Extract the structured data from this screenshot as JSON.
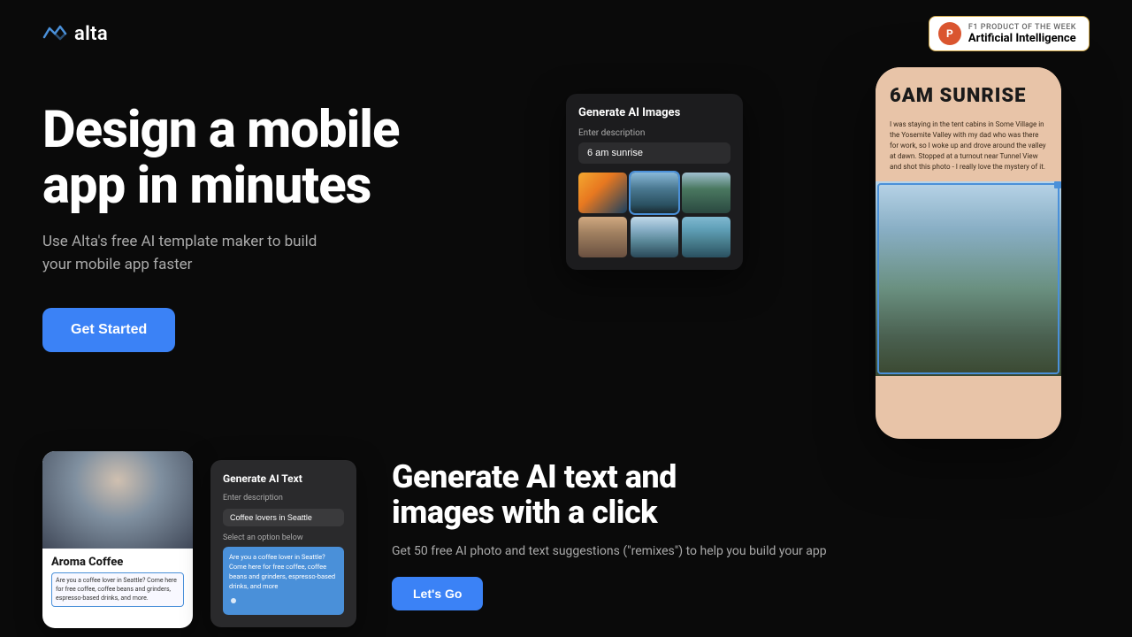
{
  "brand": {
    "logo_text": "alta",
    "logo_icon_label": "alta-logo-icon"
  },
  "product_hunt": {
    "label": "F1 PRODUCT OF THE WEEK",
    "title": "Artificial Intelligence",
    "icon_letter": "P"
  },
  "hero": {
    "headline_line1": "Design a mobile",
    "headline_line2": "app in minutes",
    "subtext": "Use Alta's free AI template maker to build your mobile app faster",
    "cta_button": "Get Started"
  },
  "mobile_app": {
    "title": "6AM SUNRISE",
    "body": "I was staying in the tent cabins in Some Village in the Yosemite Valley with my dad who was there for work, so I woke up and drove around the valley at dawn. Stopped at a turnout near Tunnel View and shot this photo - I really love the mystery of it."
  },
  "ai_images_popup": {
    "title": "Generate AI Images",
    "input_label": "Enter description",
    "input_value": "6 am sunrise",
    "images": [
      {
        "name": "sunrise-thumb",
        "style": "sunrise"
      },
      {
        "name": "mountain-thumb",
        "style": "mountain",
        "selected": true
      },
      {
        "name": "forest-thumb",
        "style": "forest"
      },
      {
        "name": "lake-thumb",
        "style": "lake"
      },
      {
        "name": "valley-thumb",
        "style": "valley"
      },
      {
        "name": "canyon-thumb",
        "style": "canyon"
      }
    ]
  },
  "bottom_section": {
    "coffee_app": {
      "image_alt": "coffee shop photo with people holding cups",
      "name": "Aroma Coffee",
      "description": "Are you a coffee lover in Seattle? Come here for free coffee, coffee beans and grinders, espresso-based drinks, and more."
    },
    "ai_text_popup": {
      "title": "Generate AI Text",
      "input_label": "Enter description",
      "input_value": "Coffee lovers in Seattle",
      "select_label": "Select an option below",
      "result_text": "Are you a coffee lover in Seattle? Come here for free coffee, coffee beans and grinders, espresso-based drinks, and more"
    },
    "right_cta": {
      "headline_line1": "Generate AI text and",
      "headline_line2": "images with a click",
      "subtext": "Get 50 free AI photo and text suggestions (\"remixes\") to help you build your app",
      "button_label": "Let's Go"
    }
  }
}
